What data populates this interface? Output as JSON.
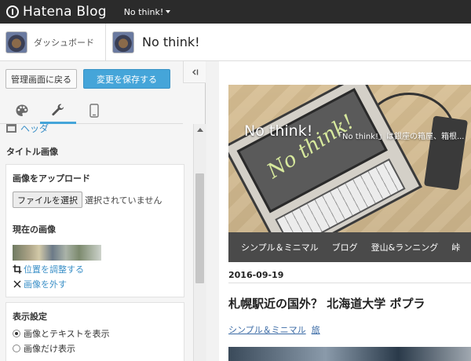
{
  "topbar": {
    "logo_text": "Hatena Blog",
    "blog_switch_label": "No think!"
  },
  "subbar": {
    "dashboard_label": "ダッシュボード",
    "blog_title": "No think!"
  },
  "editor": {
    "back_button": "管理画面に戻る",
    "save_button": "変更を保存する",
    "tabs": [
      {
        "icon": "palette-icon"
      },
      {
        "icon": "wrench-icon",
        "active": true
      },
      {
        "icon": "smartphone-icon"
      }
    ],
    "section_header": "ヘッダ",
    "group_title": "タイトル画像",
    "upload": {
      "label": "画像をアップロード",
      "file_button": "ファイルを選択",
      "file_status": "選択されていません"
    },
    "current_image": {
      "label": "現在の画像",
      "adjust_link": "位置を調整する",
      "remove_link": "画像を外す"
    },
    "display": {
      "label": "表示設定",
      "options": [
        {
          "label": "画像とテキストを表示",
          "selected": true
        },
        {
          "label": "画像だけ表示",
          "selected": false
        }
      ]
    }
  },
  "preview": {
    "header_title": "No think!",
    "header_description": "「No think!」は銀座の箱屋、箱根...",
    "header_screen_text": "No think!",
    "nav": [
      "シンプル＆ミニマル",
      "ブログ",
      "登山&ランニング",
      "峠"
    ],
    "post": {
      "date": "2016-09-19",
      "title": "札幌駅近の国外？ 北海道大学 ポプラ",
      "categories": [
        "シンプル＆ミニマル",
        "旅"
      ]
    }
  },
  "colors": {
    "topbar": "#2b2b2b",
    "accent": "#45a5d9",
    "link": "#3a8fc7",
    "nav": "#4a4a4a"
  }
}
